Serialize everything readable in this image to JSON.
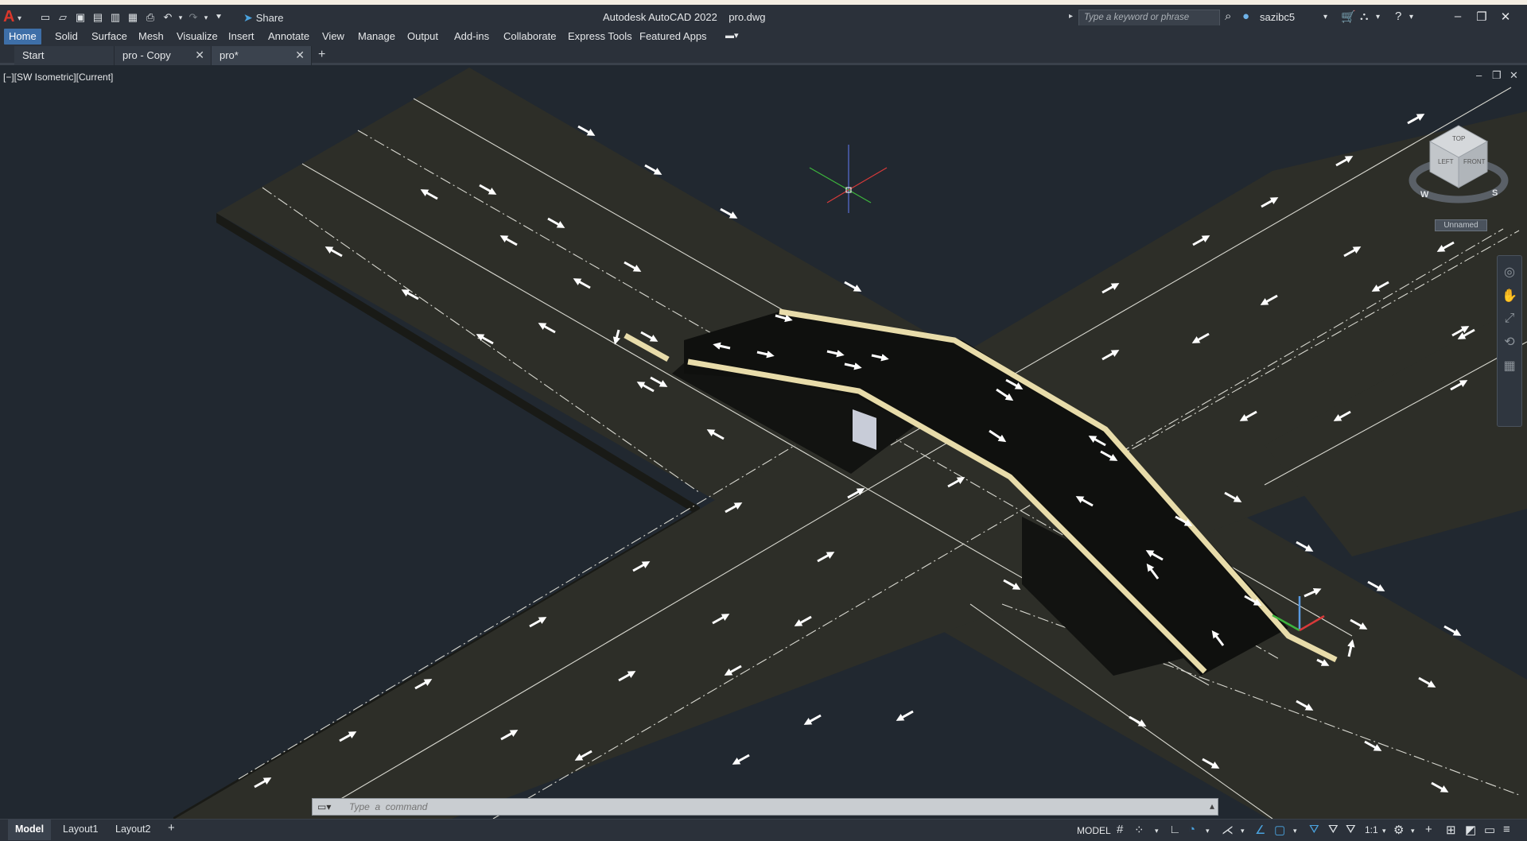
{
  "app": {
    "logo": "A",
    "title": "Autodesk AutoCAD 2022",
    "file": "pro.dwg",
    "title_line": "Autodesk AutoCAD 2022    pro.dwg"
  },
  "qat": {
    "share_label": "Share",
    "icons": [
      "new-icon",
      "open-icon",
      "save-icon",
      "save-as-icon",
      "open-web-icon",
      "save-web-icon",
      "plot-icon",
      "undo-icon",
      "redo-icon",
      "dropdown-icon"
    ]
  },
  "search": {
    "placeholder": "Type a keyword or phrase"
  },
  "user": {
    "name": "sazibc5"
  },
  "menu": {
    "items": [
      "Home",
      "Solid",
      "Surface",
      "Mesh",
      "Visualize",
      "Insert",
      "Annotate",
      "View",
      "Manage",
      "Output",
      "Add-ins",
      "Collaborate",
      "Express Tools",
      "Featured Apps"
    ],
    "active": "Home"
  },
  "tabs": [
    {
      "label": "Start"
    },
    {
      "label": "pro - Copy"
    },
    {
      "label": "pro*"
    }
  ],
  "viewport": {
    "label": "[−][SW Isometric][Current]",
    "named_view": "Unnamed",
    "viewcube": {
      "top": "TOP",
      "left": "LEFT",
      "front": "FRONT",
      "w": "W",
      "s": "S"
    }
  },
  "command": {
    "placeholder": "Type  a  command"
  },
  "status": {
    "layouts": [
      "Model",
      "Layout1",
      "Layout2"
    ],
    "active_layout": "Model",
    "space": "MODEL",
    "scale": "1:1"
  },
  "colors": {
    "accent": "#3e6fa8",
    "road": "#2d2e28",
    "deck": "#0f100e",
    "rail": "#e8dcaa",
    "background": "#212830",
    "logo": "#d9372b"
  }
}
